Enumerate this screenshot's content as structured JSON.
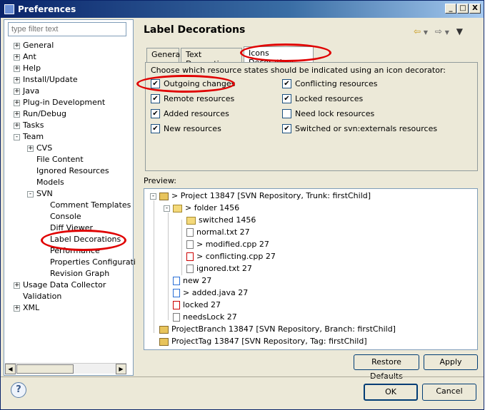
{
  "window": {
    "title": "Preferences"
  },
  "filter": {
    "placeholder": "type filter text"
  },
  "tree": [
    {
      "label": "General",
      "exp": "+"
    },
    {
      "label": "Ant",
      "exp": "+"
    },
    {
      "label": "Help",
      "exp": "+"
    },
    {
      "label": "Install/Update",
      "exp": "+"
    },
    {
      "label": "Java",
      "exp": "+"
    },
    {
      "label": "Plug-in Development",
      "exp": "+"
    },
    {
      "label": "Run/Debug",
      "exp": "+"
    },
    {
      "label": "Tasks",
      "exp": "+"
    },
    {
      "label": "Team",
      "exp": "-"
    },
    {
      "label": "CVS",
      "exp": "+"
    },
    {
      "label": "File Content",
      "exp": ""
    },
    {
      "label": "Ignored Resources",
      "exp": ""
    },
    {
      "label": "Models",
      "exp": ""
    },
    {
      "label": "SVN",
      "exp": "-"
    },
    {
      "label": "Comment Templates",
      "exp": ""
    },
    {
      "label": "Console",
      "exp": ""
    },
    {
      "label": "Diff Viewer",
      "exp": ""
    },
    {
      "label": "Label Decorations",
      "exp": ""
    },
    {
      "label": "Performance",
      "exp": ""
    },
    {
      "label": "Properties Configurati",
      "exp": ""
    },
    {
      "label": "Revision Graph",
      "exp": ""
    },
    {
      "label": "Usage Data Collector",
      "exp": "+"
    },
    {
      "label": "Validation",
      "exp": ""
    },
    {
      "label": "XML",
      "exp": "+"
    }
  ],
  "page": {
    "title": "Label Decorations"
  },
  "tabs": [
    "General",
    "Text Decorations",
    "Icons Decorations"
  ],
  "description": "Choose which resource states should be indicated using an icon decorator:",
  "options_left": [
    {
      "label": "Outgoing changes",
      "checked": true
    },
    {
      "label": "Remote resources",
      "checked": true
    },
    {
      "label": "Added resources",
      "checked": true
    },
    {
      "label": "New resources",
      "checked": true
    }
  ],
  "options_right": [
    {
      "label": "Conflicting resources",
      "checked": true
    },
    {
      "label": "Locked resources",
      "checked": true
    },
    {
      "label": "Need lock resources",
      "checked": false
    },
    {
      "label": "Switched or svn:externals resources",
      "checked": true
    }
  ],
  "preview": {
    "label": "Preview:",
    "rows": [
      {
        "label": "> Project 13847 [SVN Repository, Trunk: firstChild]",
        "icon": "project"
      },
      {
        "label": "> folder 1456",
        "icon": "folder"
      },
      {
        "label": "switched 1456",
        "icon": "folder"
      },
      {
        "label": "normal.txt 27",
        "icon": "file"
      },
      {
        "label": "> modified.cpp 27",
        "icon": "file"
      },
      {
        "label": "> conflicting.cpp 27",
        "icon": "conflict"
      },
      {
        "label": "ignored.txt 27",
        "icon": "file"
      },
      {
        "label": "new 27",
        "icon": "new"
      },
      {
        "label": "> added.java 27",
        "icon": "new"
      },
      {
        "label": "locked 27",
        "icon": "conflict"
      },
      {
        "label": "needsLock 27",
        "icon": "file"
      },
      {
        "label": "ProjectBranch 13847 [SVN Repository, Branch: firstChild]",
        "icon": "project"
      },
      {
        "label": "ProjectTag 13847 [SVN Repository, Tag: firstChild]",
        "icon": "project"
      }
    ]
  },
  "buttons": {
    "restore": "Restore Defaults",
    "apply": "Apply",
    "ok": "OK",
    "cancel": "Cancel",
    "help": "?"
  },
  "titlebar_buttons": {
    "minimize": "_",
    "maximize": "□",
    "close": "X"
  },
  "icons": {
    "back": "⇦",
    "forward": "⇨",
    "menu": "▼"
  },
  "colors": {
    "highlight_ellipse": "#e00000",
    "title_bar": "#0a246a"
  }
}
